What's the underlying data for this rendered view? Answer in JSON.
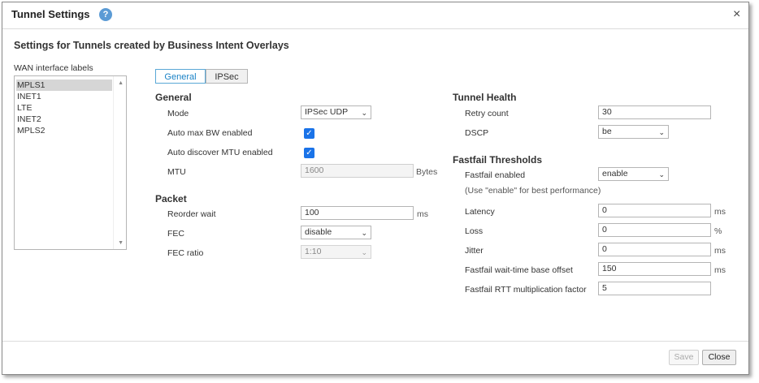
{
  "dialog": {
    "title": "Tunnel Settings",
    "help": "?",
    "close": "×",
    "heading": "Settings for Tunnels created by Business Intent Overlays"
  },
  "wan": {
    "label": "WAN interface labels",
    "items": [
      "MPLS1",
      "INET1",
      "LTE",
      "INET2",
      "MPLS2"
    ],
    "selected": "MPLS1",
    "scroll_up": "▲",
    "scroll_down": "▼"
  },
  "tabs": [
    "General",
    "IPSec"
  ],
  "active_tab": "General",
  "general": {
    "title": "General",
    "mode": {
      "label": "Mode",
      "value": "IPSec UDP"
    },
    "auto_max_bw": {
      "label": "Auto max BW enabled",
      "checked": true
    },
    "auto_mtu": {
      "label": "Auto discover MTU enabled",
      "checked": true
    },
    "mtu": {
      "label": "MTU",
      "value": "1600",
      "unit": "Bytes"
    }
  },
  "packet": {
    "title": "Packet",
    "reorder_wait": {
      "label": "Reorder wait",
      "value": "100",
      "unit": "ms"
    },
    "fec": {
      "label": "FEC",
      "value": "disable"
    },
    "fec_ratio": {
      "label": "FEC ratio",
      "value": "1:10"
    }
  },
  "health": {
    "title": "Tunnel Health",
    "retry_count": {
      "label": "Retry count",
      "value": "30"
    },
    "dscp": {
      "label": "DSCP",
      "value": "be"
    }
  },
  "fastfail": {
    "title": "Fastfail Thresholds",
    "enabled": {
      "label": "Fastfail enabled",
      "value": "enable"
    },
    "hint": "(Use \"enable\" for best performance)",
    "latency": {
      "label": "Latency",
      "value": "0",
      "unit": "ms"
    },
    "loss": {
      "label": "Loss",
      "value": "0",
      "unit": "%"
    },
    "jitter": {
      "label": "Jitter",
      "value": "0",
      "unit": "ms"
    },
    "wait_time": {
      "label": "Fastfail wait-time base offset",
      "value": "150",
      "unit": "ms"
    },
    "rtt_factor": {
      "label": "Fastfail RTT multiplication factor",
      "value": "5"
    }
  },
  "footer": {
    "save": "Save",
    "close": "Close"
  },
  "icons": {
    "check": "✓",
    "chevron": "⌄"
  },
  "colors": {
    "accent": "#1a82c6",
    "checkbox": "#1a73e8",
    "help": "#5b9bd5"
  }
}
